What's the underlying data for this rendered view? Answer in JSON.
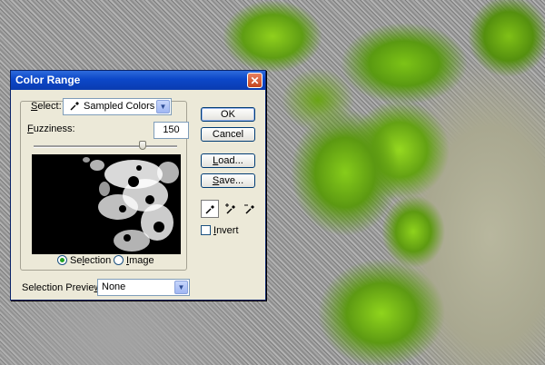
{
  "dialog": {
    "title": "Color Range",
    "close_glyph": "✕",
    "select": {
      "label": "Select:",
      "value": "Sampled Colors",
      "icon": "eyedropper-icon"
    },
    "fuzziness": {
      "label": "Fuzziness:",
      "value": "150",
      "level": 0.75
    },
    "preview_mode": {
      "selection_label": "Selection",
      "image_label": "Image",
      "selected": "selection"
    },
    "selection_preview": {
      "label": "Selection Preview:",
      "value": "None"
    },
    "buttons": {
      "ok": "OK",
      "cancel": "Cancel",
      "load": "Load...",
      "save": "Save..."
    },
    "eyedroppers": [
      "eyedropper-icon",
      "eyedropper-plus-icon",
      "eyedropper-minus-icon"
    ],
    "invert": {
      "label": "Invert",
      "checked": false
    }
  }
}
